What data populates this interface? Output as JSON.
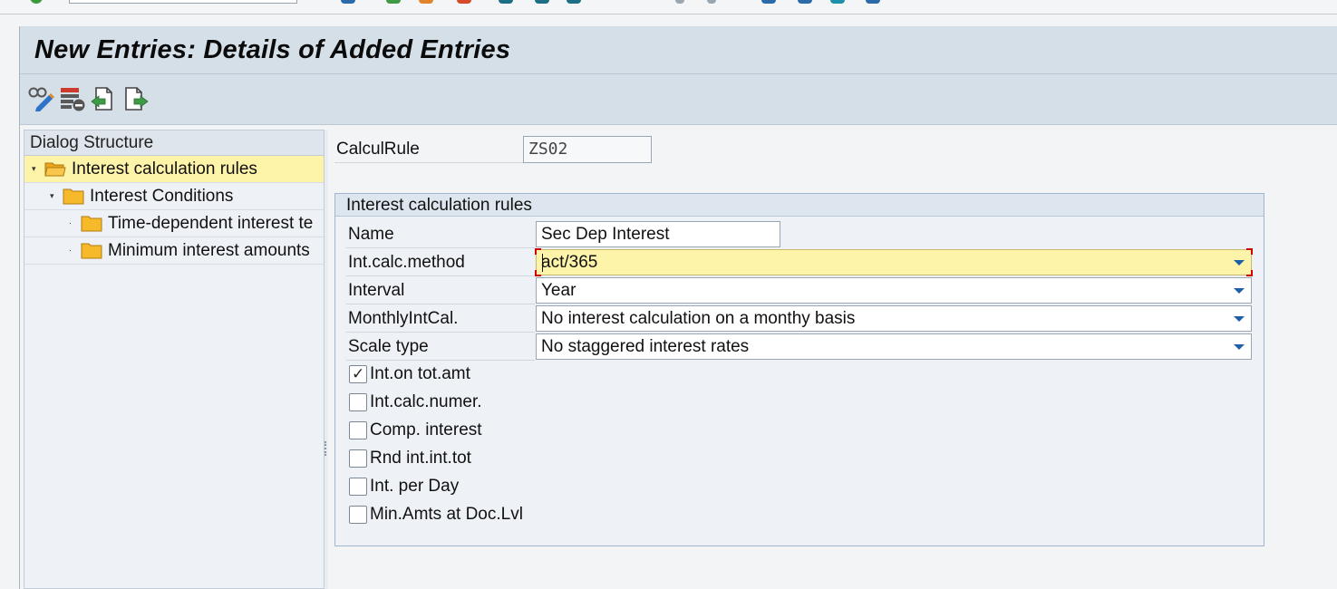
{
  "title": "New Entries: Details of Added Entries",
  "toolbar": {
    "icons": [
      "change-display-icon",
      "delete-icon",
      "previous-entry-icon",
      "next-entry-icon"
    ]
  },
  "dialog_structure": {
    "header": "Dialog Structure",
    "items": [
      {
        "label": "Interest calculation rules",
        "level": 0,
        "expanded": true,
        "selected": true,
        "open_folder": true
      },
      {
        "label": "Interest Conditions",
        "level": 1,
        "expanded": true,
        "selected": false
      },
      {
        "label": "Time-dependent interest te",
        "level": 2,
        "expanded": false,
        "selected": false
      },
      {
        "label": "Minimum interest amounts",
        "level": 2,
        "expanded": false,
        "selected": false
      }
    ]
  },
  "calcul_rule": {
    "label": "CalculRule",
    "value": "ZS02"
  },
  "group": {
    "title": "Interest calculation rules",
    "fields": [
      {
        "label": "Name",
        "value": "Sec Dep Interest",
        "type": "text"
      },
      {
        "label": "Int.calc.method",
        "value": "act/365",
        "type": "dropdown",
        "focused": true
      },
      {
        "label": "Interval",
        "value": "Year",
        "type": "dropdown"
      },
      {
        "label": "MonthlyIntCal.",
        "value": "No interest calculation on a monthy basis",
        "type": "dropdown"
      },
      {
        "label": "Scale type",
        "value": "No staggered interest rates",
        "type": "dropdown"
      }
    ],
    "checkboxes": [
      {
        "label": "Int.on tot.amt",
        "checked": true
      },
      {
        "label": "Int.calc.numer.",
        "checked": false
      },
      {
        "label": "Comp. interest",
        "checked": false
      },
      {
        "label": "Rnd int.int.tot",
        "checked": false
      },
      {
        "label": "Int. per Day",
        "checked": false
      },
      {
        "label": "Min.Amts at Doc.Lvl",
        "checked": false
      }
    ]
  },
  "colors": {
    "title_bar": "#d5dfe8",
    "selected_row": "#fdf3a9",
    "folder": "#f6b92a",
    "focus_border": "#d10000",
    "dropdown_arrow": "#1f5fa8"
  }
}
